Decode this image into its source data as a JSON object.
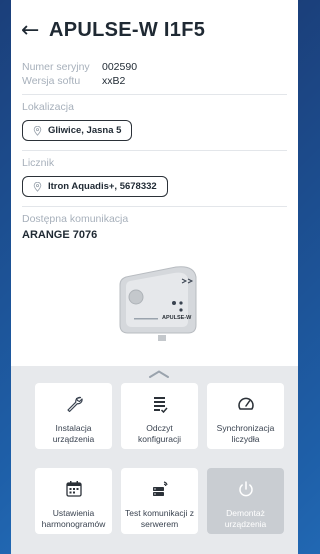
{
  "header": {
    "title": "APULSE-W I1F5",
    "back_icon": "arrow-left-icon"
  },
  "info": {
    "serial_label": "Numer seryjny",
    "serial_value": "002590",
    "software_label": "Wersja softu",
    "software_value": "xxB2"
  },
  "location": {
    "label": "Lokalizacja",
    "value": "Gliwice, Jasna 5"
  },
  "meter": {
    "label": "Licznik",
    "value": "Itron Aquadis+, 5678332"
  },
  "communication": {
    "label": "Dostępna komunikacja",
    "value": "ARANGE 7076"
  },
  "device_image": {
    "brand_text": "APULSE-W"
  },
  "actions": [
    {
      "label": "Instalacja urządzenia",
      "icon": "wrench-icon",
      "disabled": false
    },
    {
      "label": "Odczyt konfiguracji",
      "icon": "config-list-icon",
      "disabled": false
    },
    {
      "label": "Synchronizacja liczydła",
      "icon": "gauge-icon",
      "disabled": false
    },
    {
      "label": "Ustawienia harmonogramów",
      "icon": "calendar-icon",
      "disabled": false
    },
    {
      "label": "Test komunikacji z serwerem",
      "icon": "server-signal-icon",
      "disabled": false
    },
    {
      "label": "Demontaż urządzenia",
      "icon": "power-icon",
      "disabled": true
    }
  ]
}
